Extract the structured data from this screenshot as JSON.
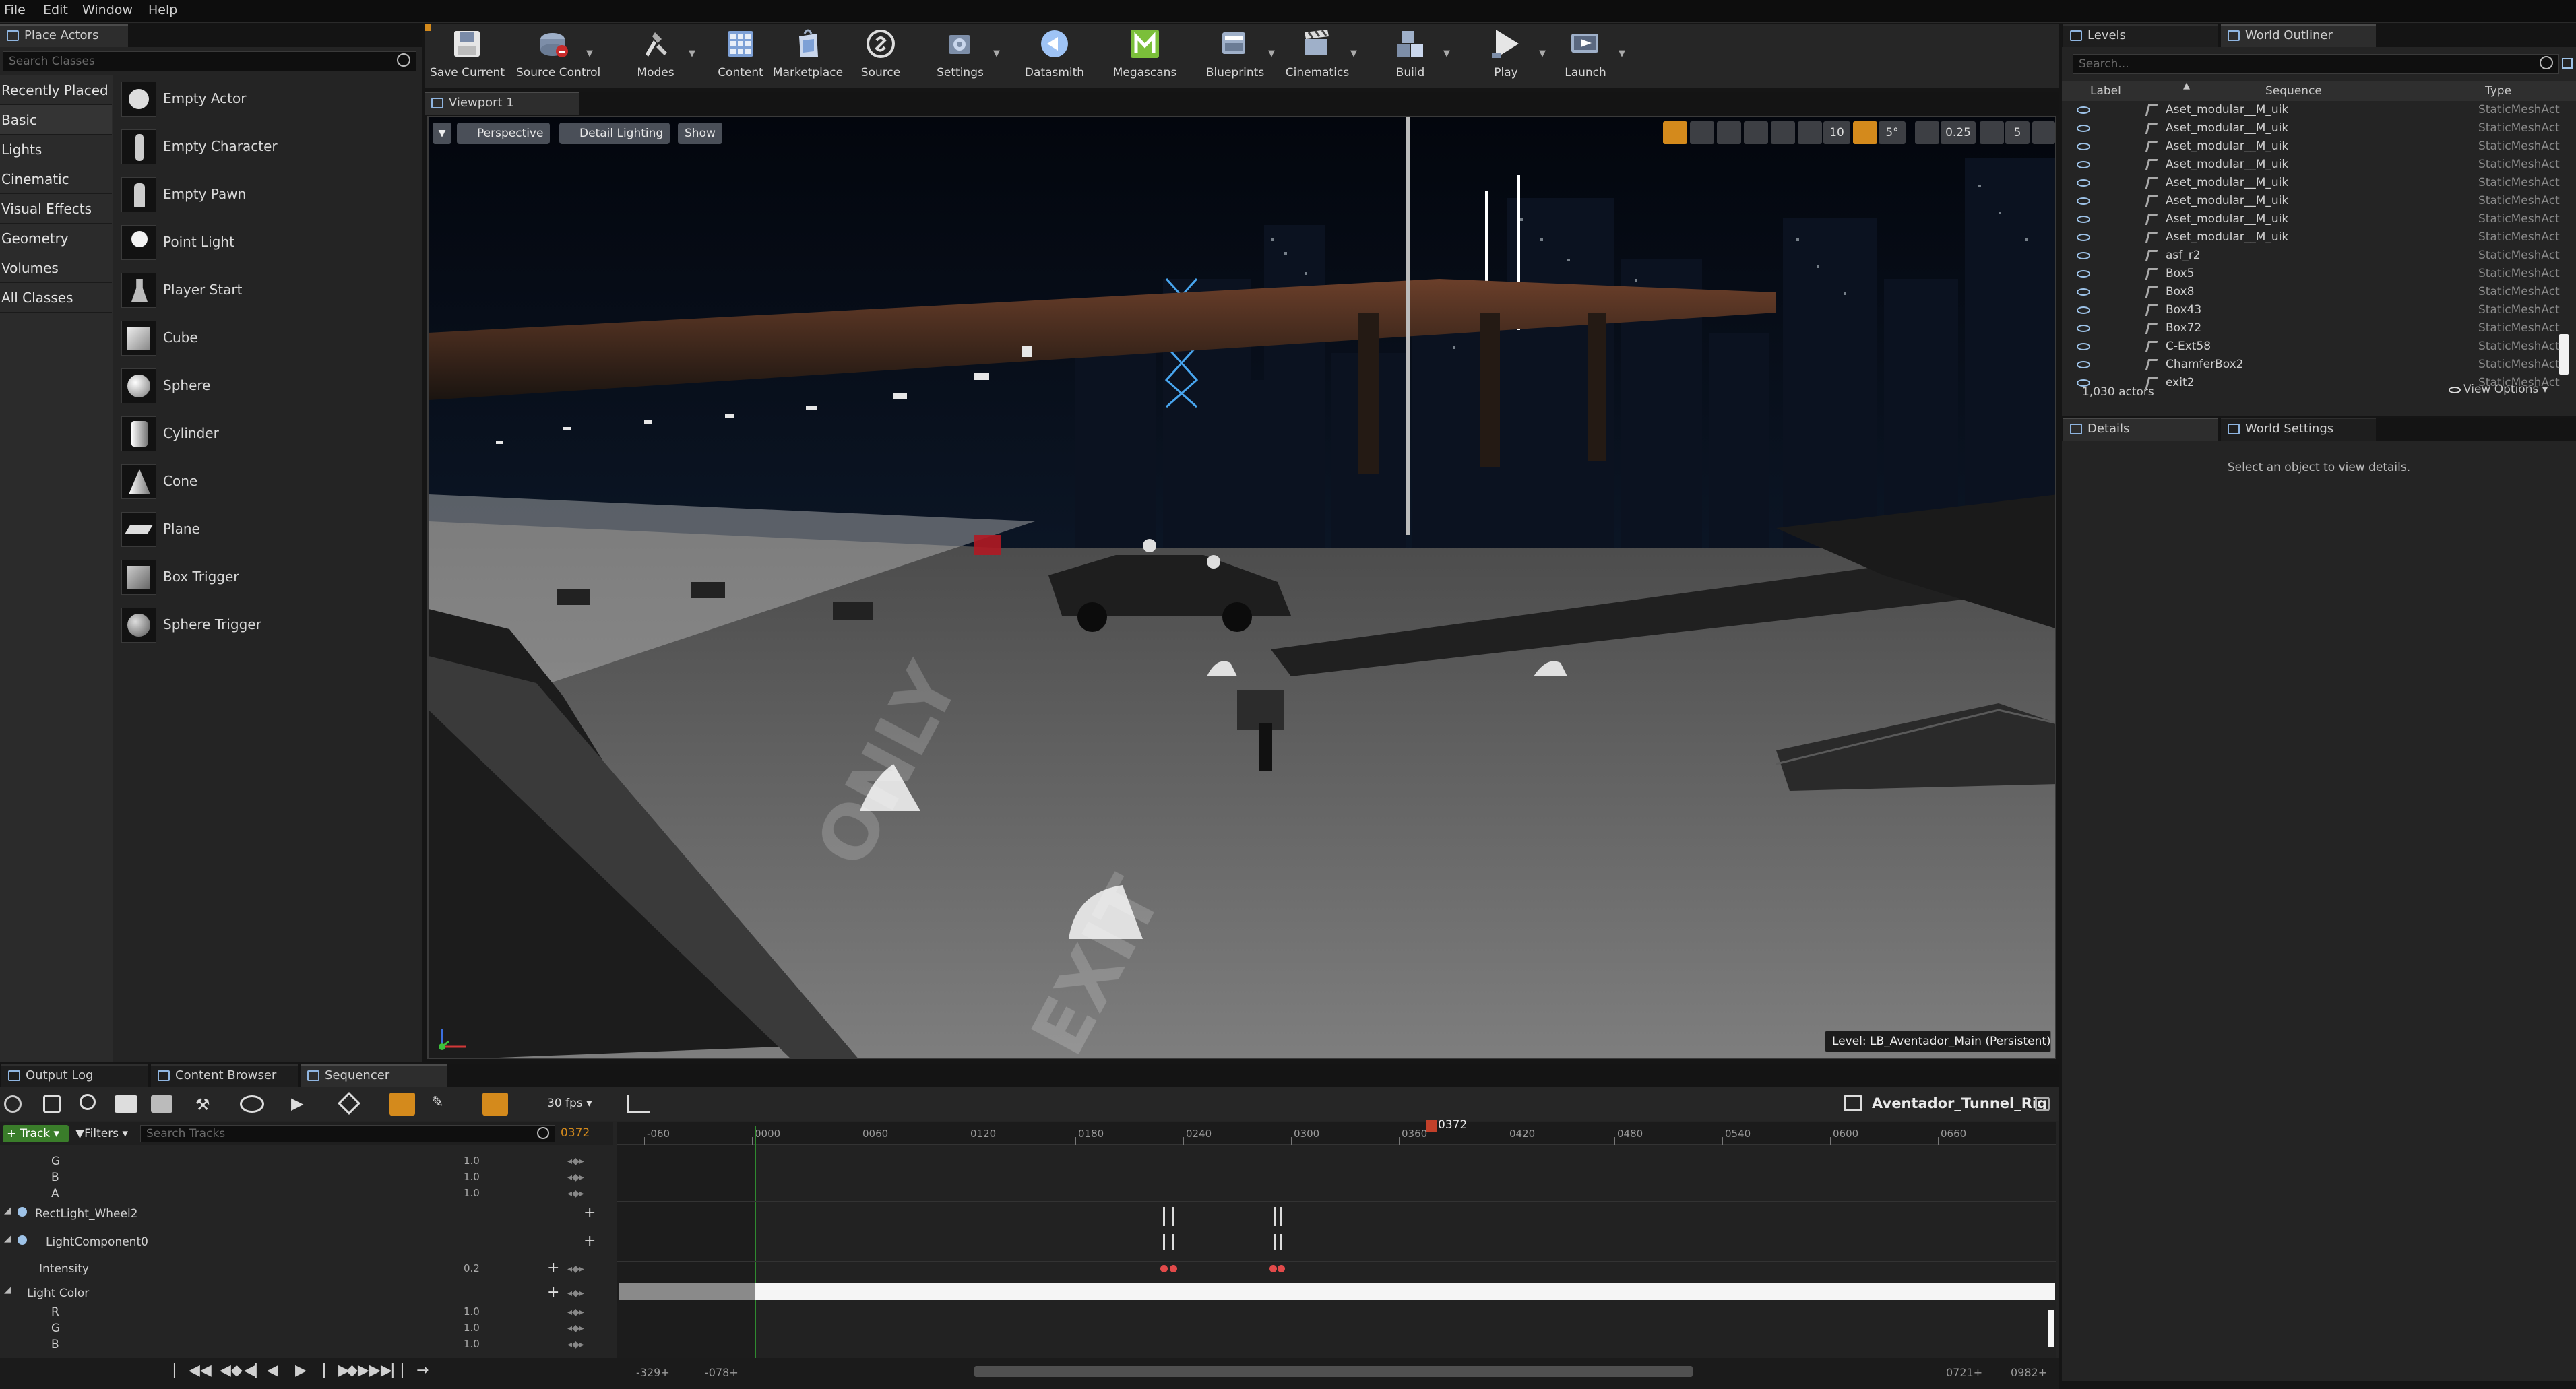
{
  "menu": [
    "File",
    "Edit",
    "Window",
    "Help"
  ],
  "place_actors": {
    "tab": "Place Actors",
    "search_placeholder": "Search Classes",
    "categories": [
      "Recently Placed",
      "Basic",
      "Lights",
      "Cinematic",
      "Visual Effects",
      "Geometry",
      "Volumes",
      "All Classes"
    ],
    "items": [
      "Empty Actor",
      "Empty Character",
      "Empty Pawn",
      "Point Light",
      "Player Start",
      "Cube",
      "Sphere",
      "Cylinder",
      "Cone",
      "Plane",
      "Box Trigger",
      "Sphere Trigger"
    ]
  },
  "toolbar": [
    {
      "label": "Save Current",
      "icon": "save-icon"
    },
    {
      "label": "Source Control",
      "icon": "source-control-icon"
    },
    {
      "label": "Modes",
      "icon": "modes-icon"
    },
    {
      "label": "Content",
      "icon": "content-icon"
    },
    {
      "label": "Marketplace",
      "icon": "marketplace-icon"
    },
    {
      "label": "Source",
      "icon": "source-icon"
    },
    {
      "label": "Settings",
      "icon": "settings-icon"
    },
    {
      "label": "Datasmith",
      "icon": "datasmith-icon"
    },
    {
      "label": "Megascans",
      "icon": "megascans-icon"
    },
    {
      "label": "Blueprints",
      "icon": "blueprints-icon"
    },
    {
      "label": "Cinematics",
      "icon": "cinematics-icon"
    },
    {
      "label": "Build",
      "icon": "build-icon"
    },
    {
      "label": "Play",
      "icon": "play-icon"
    },
    {
      "label": "Launch",
      "icon": "launch-icon"
    }
  ],
  "viewport": {
    "tab": "Viewport 1",
    "perspective": "Perspective",
    "lighting": "Detail Lighting",
    "show": "Show",
    "grid_snap": "10",
    "rot_snap": "5°",
    "scale_snap": "0.25",
    "cam_speed": "5",
    "level_label": "Level:",
    "level_name": "LB_Aventador_Main (Persistent)",
    "road_text_1": "ONLY",
    "road_text_2": "EXIT"
  },
  "outliner": {
    "tab_levels": "Levels",
    "tab_outliner": "World Outliner",
    "search_placeholder": "Search...",
    "col_label": "Label",
    "col_sequence": "Sequence",
    "col_type": "Type",
    "rows": [
      {
        "name": "Aset_modular__M_uik",
        "type": "StaticMeshAct"
      },
      {
        "name": "Aset_modular__M_uik",
        "type": "StaticMeshAct"
      },
      {
        "name": "Aset_modular__M_uik",
        "type": "StaticMeshAct"
      },
      {
        "name": "Aset_modular__M_uik",
        "type": "StaticMeshAct"
      },
      {
        "name": "Aset_modular__M_uik",
        "type": "StaticMeshAct"
      },
      {
        "name": "Aset_modular__M_uik",
        "type": "StaticMeshAct"
      },
      {
        "name": "Aset_modular__M_uik",
        "type": "StaticMeshAct"
      },
      {
        "name": "Aset_modular__M_uik",
        "type": "StaticMeshAct"
      },
      {
        "name": "asf_r2",
        "type": "StaticMeshAct"
      },
      {
        "name": "Box5",
        "type": "StaticMeshAct"
      },
      {
        "name": "Box8",
        "type": "StaticMeshAct"
      },
      {
        "name": "Box43",
        "type": "StaticMeshAct"
      },
      {
        "name": "Box72",
        "type": "StaticMeshAct"
      },
      {
        "name": "C-Ext58",
        "type": "StaticMeshAct"
      },
      {
        "name": "ChamferBox2",
        "type": "StaticMeshAct"
      },
      {
        "name": "exit2",
        "type": "StaticMeshAct"
      }
    ],
    "count": "1,030 actors",
    "view_options": "View Options"
  },
  "details": {
    "tab_details": "Details",
    "tab_world_settings": "World Settings",
    "empty_msg": "Select an object to view details."
  },
  "bottom_tabs": [
    "Output Log",
    "Content Browser",
    "Sequencer"
  ],
  "sequencer": {
    "fps": "30 fps",
    "sequence_name": "Aventador_Tunnel_Rig",
    "track_btn": "Track",
    "filters_btn": "Filters",
    "search_placeholder": "Search Tracks",
    "current_frame": "0372",
    "playhead_label": "0372",
    "ruler": [
      "-060",
      "0000",
      "0060",
      "0120",
      "0180",
      "0240",
      "0300",
      "0360",
      "0420",
      "0480",
      "0540",
      "0600",
      "0660"
    ],
    "tracks": [
      {
        "name": "G",
        "value": "1.0"
      },
      {
        "name": "B",
        "value": "1.0"
      },
      {
        "name": "A",
        "value": "1.0"
      },
      {
        "name": "RectLight_Wheel2",
        "value": ""
      },
      {
        "name": "LightComponent0",
        "value": ""
      },
      {
        "name": "Intensity",
        "value": "0.2"
      },
      {
        "name": "Light Color",
        "value": ""
      },
      {
        "name": "R",
        "value": "1.0"
      },
      {
        "name": "G",
        "value": "1.0"
      },
      {
        "name": "B",
        "value": "1.0"
      }
    ],
    "range_start_outer": "-329+",
    "range_start_inner": "-078+",
    "range_end_inner": "0721+",
    "range_end_outer": "0982+"
  }
}
